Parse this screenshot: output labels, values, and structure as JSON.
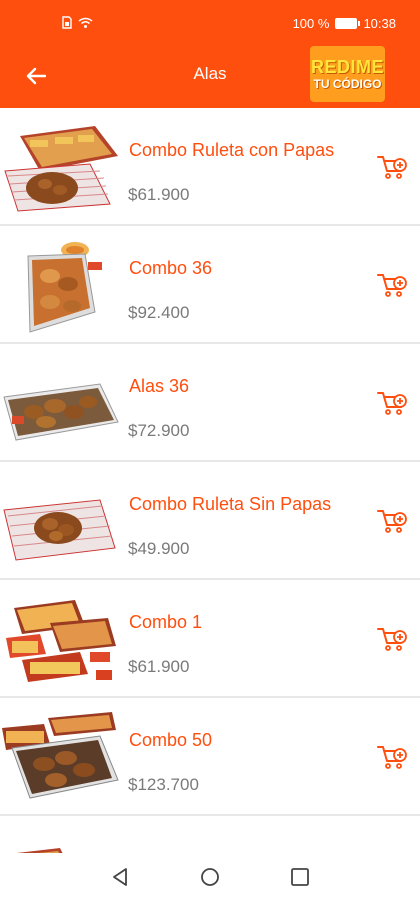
{
  "status_bar": {
    "battery_text": "100 %",
    "time": "10:38"
  },
  "header": {
    "title": "Alas",
    "redeem_line1": "REDIME",
    "redeem_line2": "TU CÓDIGO"
  },
  "colors": {
    "brand_orange": "#ff4f0f",
    "price_gray": "#7a7a7a",
    "divider": "#e8e8e8"
  },
  "products": [
    {
      "name": "Combo Ruleta con Papas",
      "price": "$61.900"
    },
    {
      "name": "Combo 36",
      "price": "$92.400"
    },
    {
      "name": "Alas 36",
      "price": "$72.900"
    },
    {
      "name": "Combo Ruleta Sin Papas",
      "price": "$49.900"
    },
    {
      "name": "Combo 1",
      "price": "$61.900"
    },
    {
      "name": "Combo 50",
      "price": "$123.700"
    }
  ],
  "icons": {
    "back": "arrow-left-icon",
    "add_to_cart": "cart-add-icon",
    "nav_back": "triangle-back-icon",
    "nav_home": "circle-home-icon",
    "nav_recents": "square-recents-icon"
  }
}
